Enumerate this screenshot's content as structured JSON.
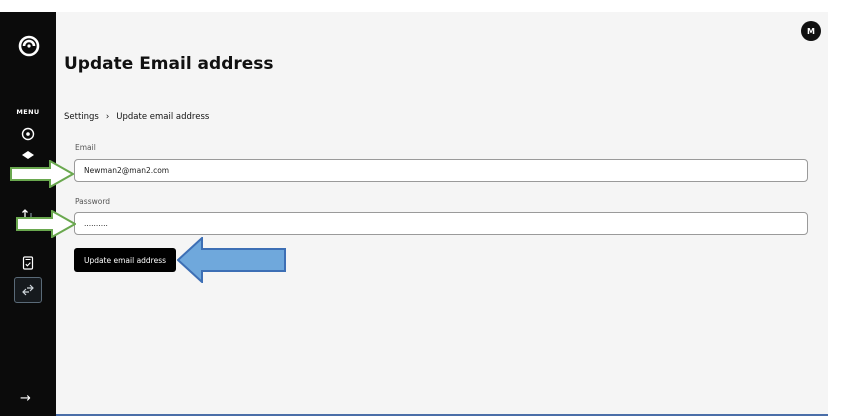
{
  "sidebar": {
    "menu_label": "MENU",
    "items": [
      {
        "icon": "dashboard-icon"
      },
      {
        "icon": "layers-icon"
      },
      {
        "icon": "transfer-icon"
      },
      {
        "icon": "document-check-icon"
      },
      {
        "icon": "exchange-icon",
        "active": true
      }
    ],
    "collapse_arrow": "→"
  },
  "header": {
    "avatar_initial": "M"
  },
  "page": {
    "title": "Update Email address",
    "breadcrumb": {
      "root": "Settings",
      "separator": "›",
      "current": "Update email address"
    }
  },
  "form": {
    "email_label": "Email",
    "email_value": "Newman2@man2.com",
    "password_label": "Password",
    "password_value": "..........",
    "submit_label": "Update email address"
  },
  "colors": {
    "sidebar": "#0b0b0b",
    "green_arrow_border": "#6aa84f",
    "blue_arrow_fill": "#6fa8dc",
    "blue_arrow_border": "#3d6fb5"
  }
}
